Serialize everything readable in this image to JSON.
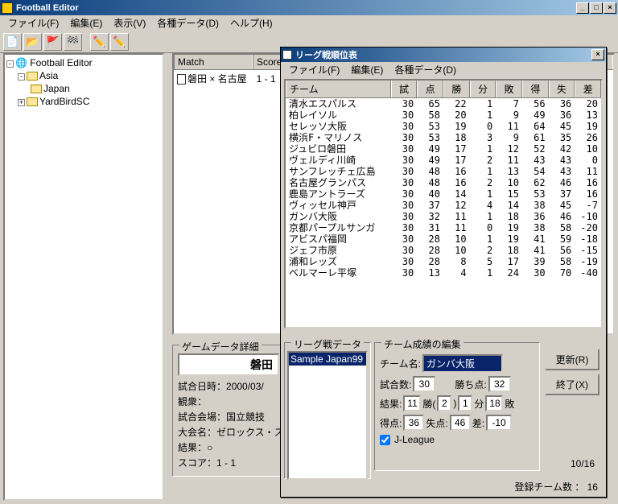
{
  "window": {
    "title": "Football Editor"
  },
  "menu": {
    "file": "ファイル(F)",
    "edit": "編集(E)",
    "view": "表示(V)",
    "data": "各種データ(D)",
    "help": "ヘルプ(H)"
  },
  "tree": {
    "root": "Football Editor",
    "asia": "Asia",
    "japan": "Japan",
    "yardbird": "YardBirdSC"
  },
  "match": {
    "col_match": "Match",
    "col_score": "Score",
    "row": "磐田 × 名古屋　1 - 1"
  },
  "detail": {
    "title": "ゲームデータ詳細",
    "team": "磐田",
    "date_l": "試合日時：",
    "date_v": "2000/03/",
    "att_l": "観衆：",
    "venue_l": "試合会場：",
    "venue_v": "国立競技",
    "cup_l": "大会名：",
    "cup_v": "ゼロックス・ス",
    "result_l": "結果：",
    "result_v": "○",
    "score_l": "スコア：",
    "score_v": "1 - 1"
  },
  "dialog": {
    "title": "リーグ戦順位表",
    "menu_file": "ファイル(F)",
    "menu_edit": "編集(E)",
    "menu_data": "各種データ(D)",
    "head": {
      "team": "チーム",
      "p": "試",
      "pts": "点",
      "w": "勝",
      "d": "分",
      "l": "敗",
      "gf": "得",
      "ga": "失",
      "gd": "差"
    },
    "rows": [
      {
        "t": "清水エスパルス",
        "p": 30,
        "pts": 65,
        "w": 22,
        "d": 1,
        "l": 7,
        "gf": 56,
        "ga": 36,
        "gd": 20
      },
      {
        "t": "柏レイソル",
        "p": 30,
        "pts": 58,
        "w": 20,
        "d": 1,
        "l": 9,
        "gf": 49,
        "ga": 36,
        "gd": 13
      },
      {
        "t": "セレッソ大阪",
        "p": 30,
        "pts": 53,
        "w": 19,
        "d": 0,
        "l": 11,
        "gf": 64,
        "ga": 45,
        "gd": 19
      },
      {
        "t": "横浜F・マリノス",
        "p": 30,
        "pts": 53,
        "w": 18,
        "d": 3,
        "l": 9,
        "gf": 61,
        "ga": 35,
        "gd": 26
      },
      {
        "t": "ジュビロ磐田",
        "p": 30,
        "pts": 49,
        "w": 17,
        "d": 1,
        "l": 12,
        "gf": 52,
        "ga": 42,
        "gd": 10
      },
      {
        "t": "ヴェルディ川崎",
        "p": 30,
        "pts": 49,
        "w": 17,
        "d": 2,
        "l": 11,
        "gf": 43,
        "ga": 43,
        "gd": 0
      },
      {
        "t": "サンフレッチェ広島",
        "p": 30,
        "pts": 48,
        "w": 16,
        "d": 1,
        "l": 13,
        "gf": 54,
        "ga": 43,
        "gd": 11
      },
      {
        "t": "名古屋グランパス",
        "p": 30,
        "pts": 48,
        "w": 16,
        "d": 2,
        "l": 10,
        "gf": 62,
        "ga": 46,
        "gd": 16
      },
      {
        "t": "鹿島アントラーズ",
        "p": 30,
        "pts": 40,
        "w": 14,
        "d": 1,
        "l": 15,
        "gf": 53,
        "ga": 37,
        "gd": 16
      },
      {
        "t": "ヴィッセル神戸",
        "p": 30,
        "pts": 37,
        "w": 12,
        "d": 4,
        "l": 14,
        "gf": 38,
        "ga": 45,
        "gd": -7
      },
      {
        "t": "ガンバ大阪",
        "p": 30,
        "pts": 32,
        "w": 11,
        "d": 1,
        "l": 18,
        "gf": 36,
        "ga": 46,
        "gd": -10
      },
      {
        "t": "京都パープルサンガ",
        "p": 30,
        "pts": 31,
        "w": 11,
        "d": 0,
        "l": 19,
        "gf": 38,
        "ga": 58,
        "gd": -20
      },
      {
        "t": "アビスパ福岡",
        "p": 30,
        "pts": 28,
        "w": 10,
        "d": 1,
        "l": 19,
        "gf": 41,
        "ga": 59,
        "gd": -18
      },
      {
        "t": "ジェフ市原",
        "p": 30,
        "pts": 28,
        "w": 10,
        "d": 2,
        "l": 18,
        "gf": 41,
        "ga": 56,
        "gd": -15
      },
      {
        "t": "浦和レッズ",
        "p": 30,
        "pts": 28,
        "w": 8,
        "d": 5,
        "l": 17,
        "gf": 39,
        "ga": 58,
        "gd": -19
      },
      {
        "t": "ベルマーレ平塚",
        "p": 30,
        "pts": 13,
        "w": 4,
        "d": 1,
        "l": 24,
        "gf": 30,
        "ga": 70,
        "gd": -40
      }
    ],
    "leaguedata": {
      "label": "リーグ戦データ",
      "item": "Sample Japan99"
    },
    "edit": {
      "label": "チーム成績の編集",
      "name_l": "チーム名:",
      "name_v": "ガンバ大阪",
      "played_l": "試合数:",
      "played_v": "30",
      "points_l": "勝ち点:",
      "points_v": "32",
      "result_l": "結果:",
      "w": "11",
      "w_s": "勝(",
      "ext": "2",
      "ext_s": ")",
      "d": "1",
      "d_s": "分",
      "l": "18",
      "l_s": "敗",
      "gf_l": "得点:",
      "gf_v": "36",
      "ga_l": "失点:",
      "ga_v": "46",
      "gd_l": "差:",
      "gd_v": "-10",
      "jleague": "J-League"
    },
    "buttons": {
      "update": "更新(R)",
      "close": "終了(X)"
    },
    "counter": "10/16",
    "footer": "登録チーム数 ： 16"
  }
}
